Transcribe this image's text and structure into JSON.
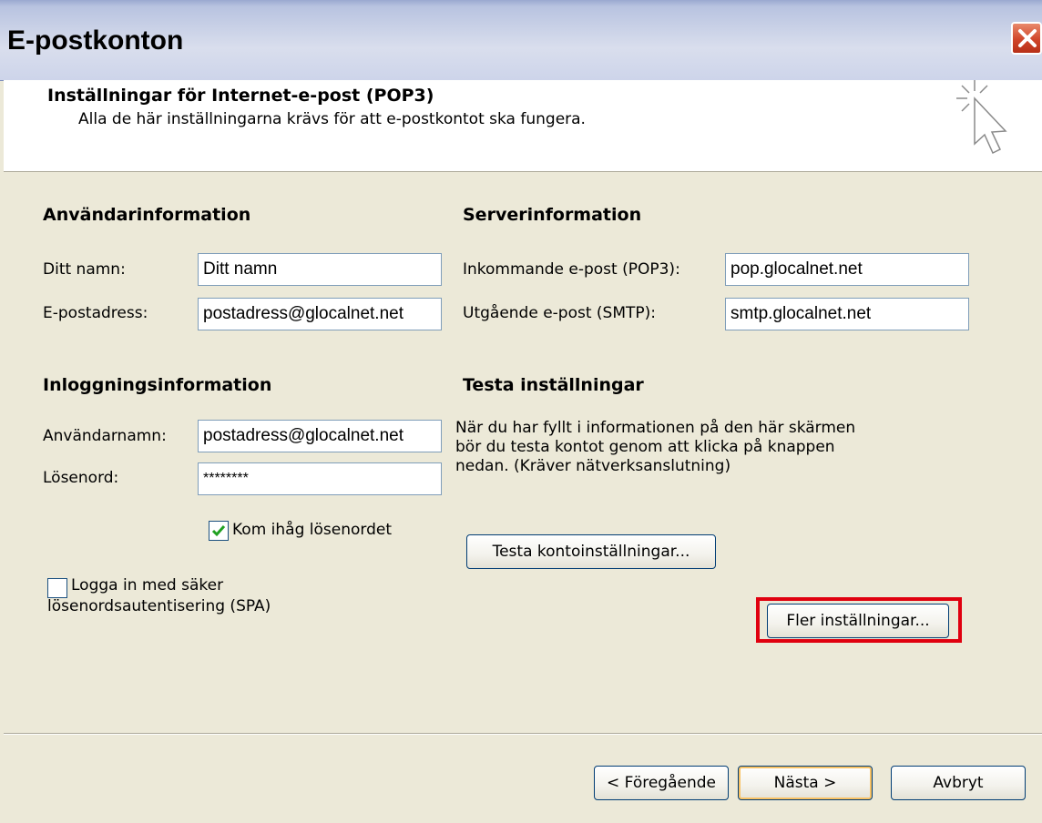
{
  "window": {
    "title": "E-postkonton"
  },
  "header": {
    "title": "Inställningar för Internet-e-post (POP3)",
    "subtitle": "Alla de här inställningarna krävs för att e-postkontot ska fungera."
  },
  "user_info": {
    "heading": "Användarinformation",
    "name_label": "Ditt namn:",
    "name_value": "Ditt namn",
    "email_label": "E-postadress:",
    "email_value": "postadress@glocalnet.net"
  },
  "server_info": {
    "heading": "Serverinformation",
    "incoming_label": "Inkommande e-post (POP3):",
    "incoming_value": "pop.glocalnet.net",
    "outgoing_label": "Utgående e-post (SMTP):",
    "outgoing_value": "smtp.glocalnet.net"
  },
  "login_info": {
    "heading": "Inloggningsinformation",
    "username_label": "Användarnamn:",
    "username_value": "postadress@glocalnet.net",
    "password_label": "Lösenord:",
    "password_value": "********",
    "remember_label": "Kom ihåg lösenordet",
    "remember_checked": true,
    "spa_label_line1": "Logga in med säker",
    "spa_label_line2": "lösenordsautentisering (SPA)",
    "spa_checked": false
  },
  "test_settings": {
    "heading": "Testa inställningar",
    "desc_line1": "När du har fyllt i informationen på den här skärmen",
    "desc_line2": "bör du testa kontot genom att klicka på knappen",
    "desc_line3": "nedan. (Kräver nätverksanslutning)",
    "test_button": "Testa kontoinställningar...",
    "more_button": "Fler inställningar..."
  },
  "footer": {
    "back_button": "< Föregående",
    "next_button": "Nästa >",
    "cancel_button": "Avbryt"
  },
  "colors": {
    "highlight": "#e0000f",
    "field_border": "#7f9db9",
    "button_border": "#003c74"
  }
}
